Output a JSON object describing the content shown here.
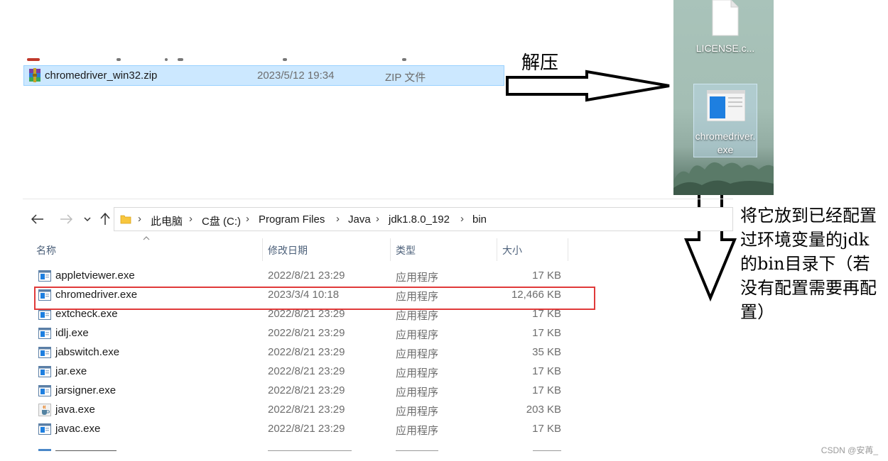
{
  "zip_file": {
    "name": "chromedriver_win32.zip",
    "date": "2023/5/12 19:34",
    "type": "ZIP 文件",
    "icon": "winrar-archive-icon"
  },
  "annotations": {
    "unzip": "解压",
    "place": "将它放到已经配置过环境变量的jdk的bin目录下（若没有配置需要再配置）",
    "arrow_color": "#000000",
    "highlight_color": "#e03a3a"
  },
  "desktop": {
    "icons": [
      {
        "label": "LICENSE.c...",
        "icon": "document-icon"
      },
      {
        "label": "chromedriver.exe",
        "icon": "application-icon"
      }
    ]
  },
  "explorer": {
    "breadcrumb": [
      "此电脑",
      "C盘 (C:)",
      "Program Files",
      "Java",
      "jdk1.8.0_192",
      "bin"
    ],
    "columns": [
      "名称",
      "修改日期",
      "类型",
      "大小"
    ],
    "files": [
      {
        "name": "appletviewer.exe",
        "date": "2022/8/21 23:29",
        "type": "应用程序",
        "size": "17 KB",
        "icon": "application-icon"
      },
      {
        "name": "chromedriver.exe",
        "date": "2023/3/4 10:18",
        "type": "应用程序",
        "size": "12,466 KB",
        "icon": "application-icon",
        "highlighted": true
      },
      {
        "name": "extcheck.exe",
        "date": "2022/8/21 23:29",
        "type": "应用程序",
        "size": "17 KB",
        "icon": "application-icon"
      },
      {
        "name": "idlj.exe",
        "date": "2022/8/21 23:29",
        "type": "应用程序",
        "size": "17 KB",
        "icon": "application-icon"
      },
      {
        "name": "jabswitch.exe",
        "date": "2022/8/21 23:29",
        "type": "应用程序",
        "size": "35 KB",
        "icon": "application-icon"
      },
      {
        "name": "jar.exe",
        "date": "2022/8/21 23:29",
        "type": "应用程序",
        "size": "17 KB",
        "icon": "application-icon"
      },
      {
        "name": "jarsigner.exe",
        "date": "2022/8/21 23:29",
        "type": "应用程序",
        "size": "17 KB",
        "icon": "application-icon"
      },
      {
        "name": "java.exe",
        "date": "2022/8/21 23:29",
        "type": "应用程序",
        "size": "203 KB",
        "icon": "java-cup-icon"
      },
      {
        "name": "javac.exe",
        "date": "2022/8/21 23:29",
        "type": "应用程序",
        "size": "17 KB",
        "icon": "application-icon"
      }
    ]
  },
  "watermark": "CSDN @安苒_"
}
